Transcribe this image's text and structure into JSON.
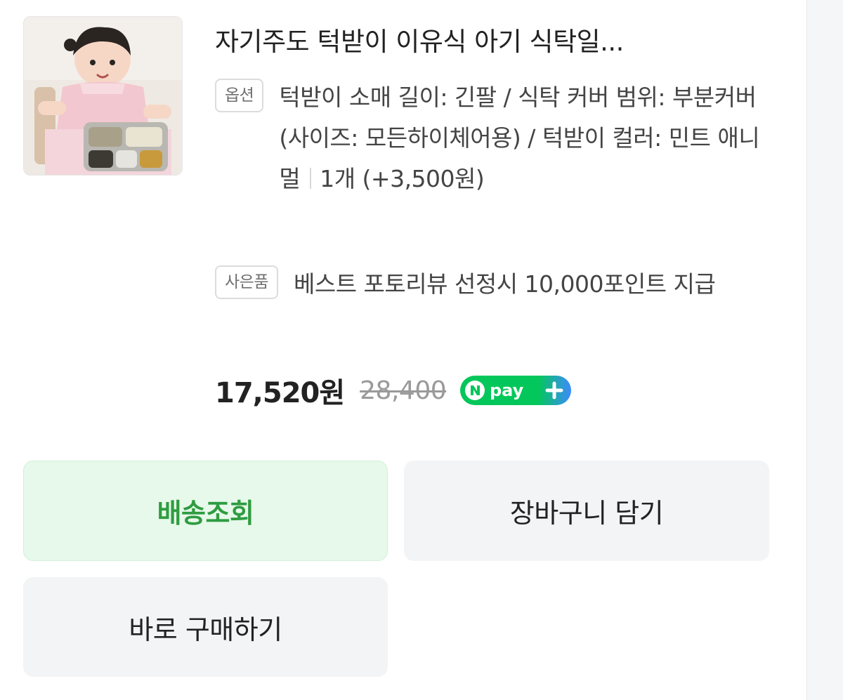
{
  "product": {
    "title": "자기주도 턱받이 이유식 아기 식탁일...",
    "option_tag": "옵션",
    "option_text": "턱받이 소매 길이: 긴팔 / 식탁 커버 범위: 부분커버 (사이즈: 모든하이체어용) / 턱받이 컬러: 민트 애니멀",
    "quantity_text": "1개 (+3,500원)",
    "gift_tag": "사은품",
    "gift_text": "베스트 포토리뷰 선정시 10,000포인트 지급",
    "price": "17,520원",
    "original_price": "28,400",
    "npay_label": "pay",
    "npay_icon": "npay-plus-logo",
    "thumbnail_alt": "baby-highchair-photo"
  },
  "actions": {
    "track_label": "배송조회",
    "cart_label": "장바구니 담기",
    "buy_label": "바로 구매하기"
  },
  "colors": {
    "track_bg": "#e7f9ea",
    "track_text": "#2f9c41",
    "neutral_button_bg": "#f3f4f6",
    "npay_green": "#03c75a",
    "npay_blue": "#3d8bfd"
  }
}
